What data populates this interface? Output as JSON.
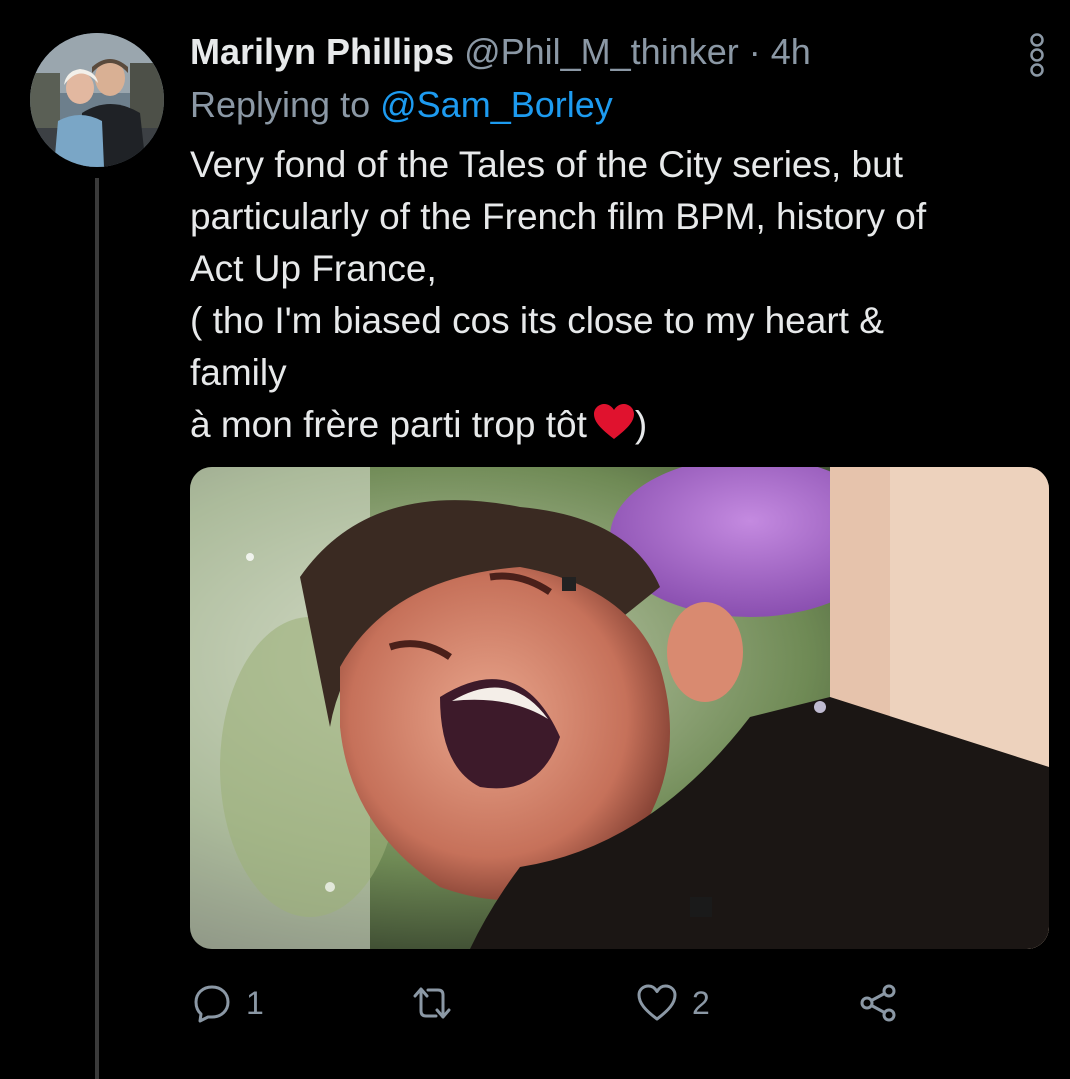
{
  "tweet": {
    "author": {
      "display_name": "Marilyn Phillips",
      "handle": "@Phil_M_thinker",
      "separator": "·",
      "time": "4h",
      "avatar_icon": "profile-photo"
    },
    "replying_prefix": "Replying to",
    "replying_to": "@Sam_Borley",
    "body_lines": [
      "Very fond of the Tales of the City series, but",
      "particularly of the French film BPM, history of",
      "Act Up France,",
      "( tho I'm biased cos its close to my heart &",
      "family",
      "à mon frère parti trop tôt"
    ],
    "body_suffix": ")",
    "media": {
      "kind": "photo"
    },
    "actions": {
      "reply_count": "1",
      "retweet_count": "",
      "like_count": "2"
    },
    "icons": {
      "more": "more-vertical-icon",
      "reply": "reply-icon",
      "retweet": "retweet-icon",
      "like": "heart-outline-icon",
      "share": "share-icon",
      "emoji": "red-heart-emoji"
    },
    "colors": {
      "background": "#000000",
      "text": "#e7e9ea",
      "secondary": "#8b98a5",
      "link": "#1d9bf0",
      "thread_line": "#3a3a3a",
      "heart": "#e0122e"
    }
  }
}
